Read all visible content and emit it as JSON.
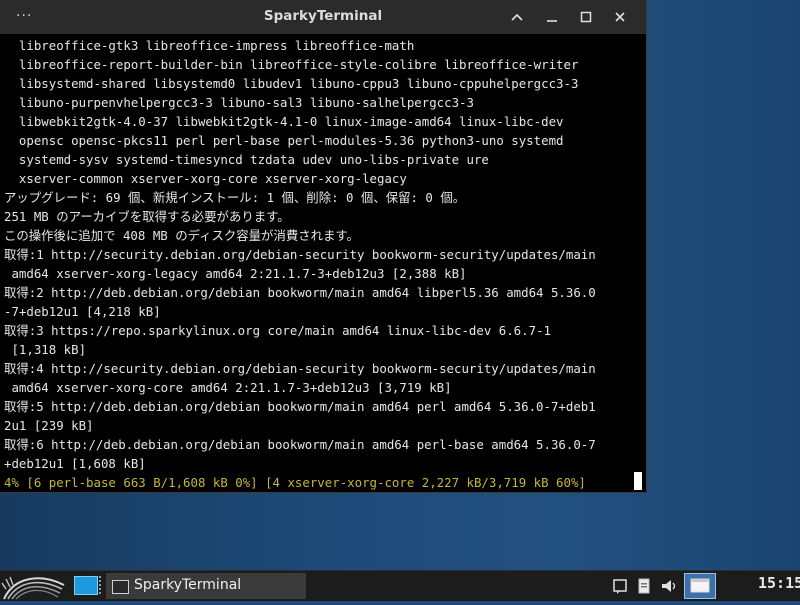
{
  "window": {
    "title": "SparkyTerminal",
    "menu_icon": "dots-menu-icon",
    "buttons": [
      "chevron-up-icon",
      "restore-icon",
      "maximize-icon",
      "close-icon"
    ]
  },
  "terminal": {
    "lines": [
      "  libreoffice-gtk3 libreoffice-impress libreoffice-math",
      "  libreoffice-report-builder-bin libreoffice-style-colibre libreoffice-writer",
      "  libsystemd-shared libsystemd0 libudev1 libuno-cppu3 libuno-cppuhelpergcc3-3",
      "  libuno-purpenvhelpergcc3-3 libuno-sal3 libuno-salhelpergcc3-3",
      "  libwebkit2gtk-4.0-37 libwebkit2gtk-4.1-0 linux-image-amd64 linux-libc-dev",
      "  opensc opensc-pkcs11 perl perl-base perl-modules-5.36 python3-uno systemd",
      "  systemd-sysv systemd-timesyncd tzdata udev uno-libs-private ure",
      "  xserver-common xserver-xorg-core xserver-xorg-legacy",
      "アップグレード: 69 個、新規インストール: 1 個、削除: 0 個、保留: 0 個。",
      "251 MB のアーカイブを取得する必要があります。",
      "この操作後に追加で 408 MB のディスク容量が消費されます。",
      "取得:1 http://security.debian.org/debian-security bookworm-security/updates/main",
      " amd64 xserver-xorg-legacy amd64 2:21.1.7-3+deb12u3 [2,388 kB]",
      "取得:2 http://deb.debian.org/debian bookworm/main amd64 libperl5.36 amd64 5.36.0",
      "-7+deb12u1 [4,218 kB]",
      "取得:3 https://repo.sparkylinux.org core/main amd64 linux-libc-dev 6.6.7-1",
      " [1,318 kB]",
      "取得:4 http://security.debian.org/debian-security bookworm-security/updates/main",
      " amd64 xserver-xorg-core amd64 2:21.1.7-3+deb12u3 [3,719 kB]",
      "取得:5 http://deb.debian.org/debian bookworm/main amd64 perl amd64 5.36.0-7+deb1",
      "2u1 [239 kB]",
      "取得:6 http://deb.debian.org/debian bookworm/main amd64 perl-base amd64 5.36.0-7",
      "+deb12u1 [1,608 kB]"
    ],
    "progress_line": "4% [6 perl-base 663 B/1,608 kB 0%] [4 xserver-xorg-core 2,227 kB/3,719 kB 60%]",
    "colors": {
      "text": "#e6e6e6",
      "progress": "#c7b53a",
      "background": "#000000"
    }
  },
  "taskbar": {
    "start_icon": "sparky-logo-icon",
    "launcher_icon": "show-desktop-icon",
    "task_label": "SparkyTerminal",
    "task_icon": "terminal-window-icon",
    "tray_icons": [
      "notes-icon",
      "clipboard-icon",
      "volume-icon",
      "workspace-icon"
    ],
    "clock": "15:15"
  }
}
